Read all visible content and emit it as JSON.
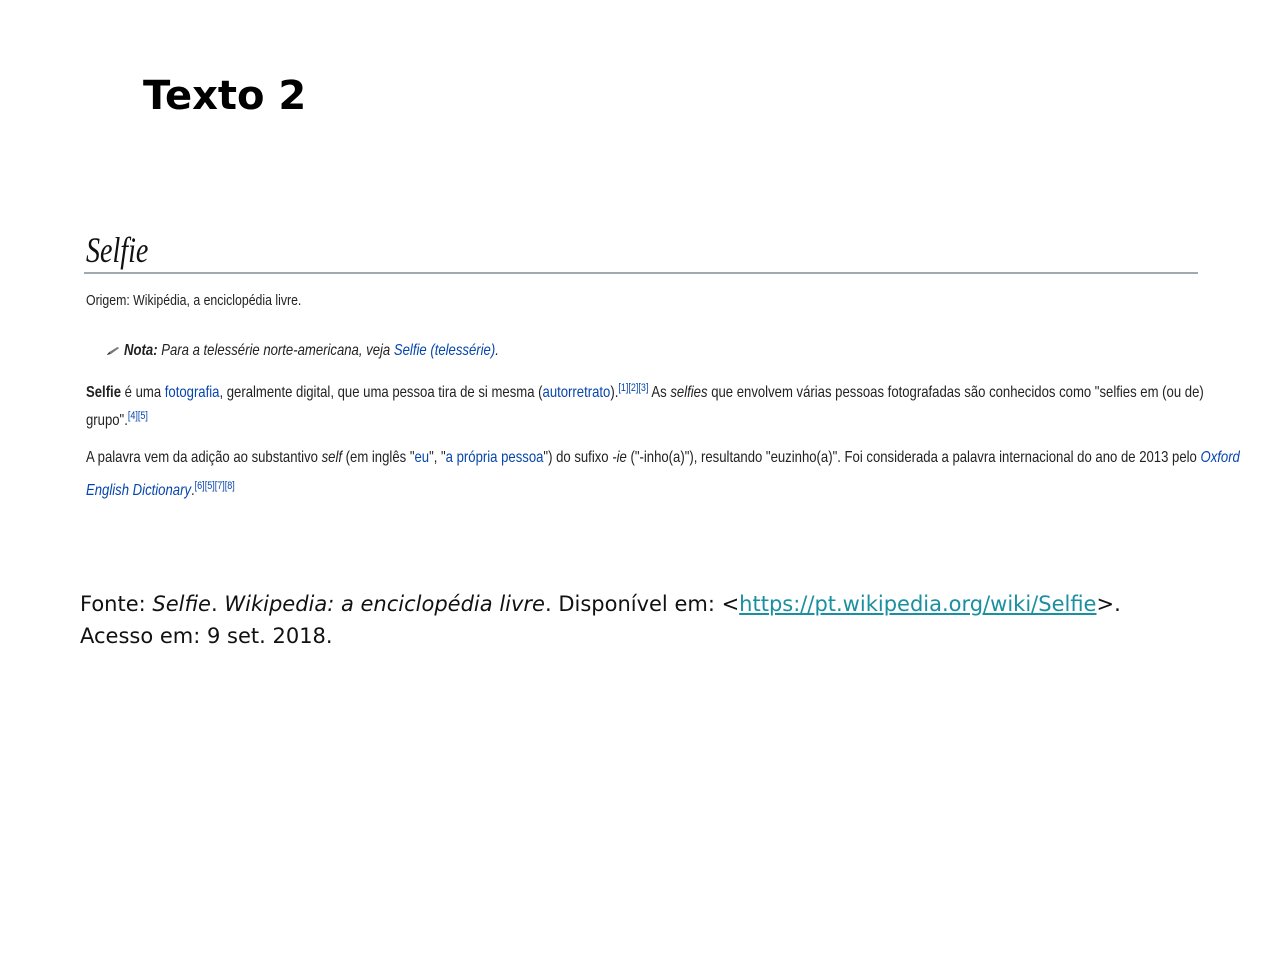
{
  "heading": "Texto 2",
  "wiki": {
    "title": "Selfie",
    "origin": "Origem: Wikipédia, a enciclopédia livre.",
    "note": {
      "label": "Nota:",
      "text": "Para a telessérie norte-americana, veja",
      "link": "Selfie (telessérie)",
      "end": "."
    },
    "p1": {
      "term": "Selfie",
      "t1": " é uma ",
      "link1": "fotografia",
      "t2": ", geralmente digital, que uma pessoa tira de si mesma (",
      "link2": "autorretrato",
      "t3": ").",
      "refs1": "[1][2][3]",
      "t4": " As ",
      "em": "selfies",
      "t5": " que envolvem várias pessoas fotografadas são conhecidos como \"selfies em (ou de)",
      "t6": "grupo\".",
      "refs2": "[4][5]"
    },
    "p2": {
      "t1": "A palavra vem da adição ao substantivo ",
      "em1": "self",
      "t2": " (em inglês \"",
      "link1": "eu",
      "t3": "\", \"",
      "link2": "a própria pessoa",
      "t4": "\") do sufixo ",
      "em2": "-ie",
      "t5": " (\"-inho(a)\"), resultando \"euzinho(a)\". Foi considerada a palavra internacional do ano de 2013 pelo ",
      "link3a": "Oxford",
      "link3b": "English Dictionary",
      "t6": ".",
      "refs": "[6][5][7][8]"
    }
  },
  "source": {
    "prefix": "Fonte: ",
    "title_italic": "Selfie",
    "sep": ". ",
    "site_italic": "Wikipedia: a enciclopédia livre",
    "available": ". Disponível em: <",
    "url": "https://pt.wikipedia.org/wiki/Selfie",
    "close": ">.",
    "access": "Acesso em: 9 set. 2018."
  }
}
